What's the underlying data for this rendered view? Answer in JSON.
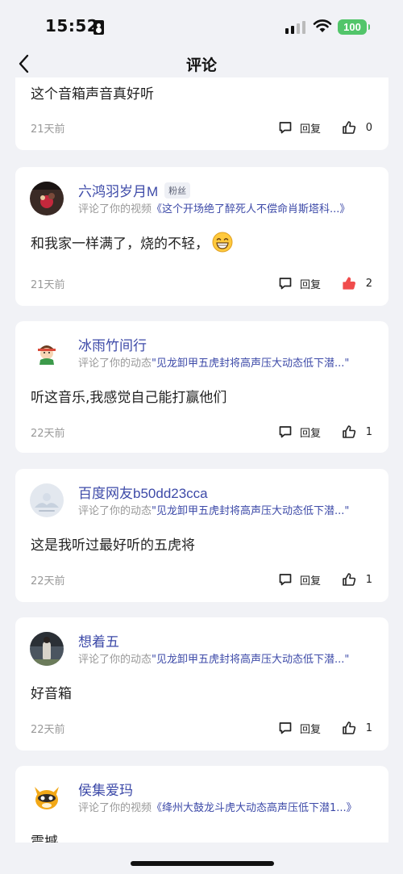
{
  "status": {
    "time": "15:52",
    "battery": "100"
  },
  "nav": {
    "title": "评论"
  },
  "partial_top": {
    "content": "这个音箱声音真好听",
    "ago": "21天前",
    "reply_label": "回复",
    "likes": "0"
  },
  "comments": [
    {
      "name": "六鸿羽岁月M",
      "badge": "粉丝",
      "prefix": "评论了你的视频",
      "target": "《这个开场绝了醉死人不偿命肖斯塔科...》",
      "content": "和我家一样满了，烧的不轻，",
      "emoji": "grinning-emoji",
      "ago": "21天前",
      "reply_label": "回复",
      "likes": "2",
      "liked": true,
      "liked_color": "#f04c4c"
    },
    {
      "name": "冰雨竹间行",
      "prefix": "评论了你的动态",
      "target": "\"见龙卸甲五虎封将高声压大动态低下潜...\"",
      "content": "听这音乐,我感觉自己能打赢他们",
      "ago": "22天前",
      "reply_label": "回复",
      "likes": "1"
    },
    {
      "name": "百度网友b50dd23cca",
      "prefix": "评论了你的动态",
      "target": "\"见龙卸甲五虎封将高声压大动态低下潜...\"",
      "content": "这是我听过最好听的五虎将",
      "ago": "22天前",
      "reply_label": "回复",
      "likes": "1"
    },
    {
      "name": "想着五",
      "prefix": "评论了你的动态",
      "target": "\"见龙卸甲五虎封将高声压大动态低下潜...\"",
      "content": "好音箱",
      "ago": "22天前",
      "reply_label": "回复",
      "likes": "1"
    },
    {
      "name": "侯集爱玛",
      "prefix": "评论了你的视频",
      "target": "《绛州大鼓龙斗虎大动态高声压低下潜1...》",
      "content": "震撼"
    }
  ],
  "colors": {
    "link": "#3d4aa8",
    "background": "#f1f2f6",
    "battery": "#52c56a"
  }
}
